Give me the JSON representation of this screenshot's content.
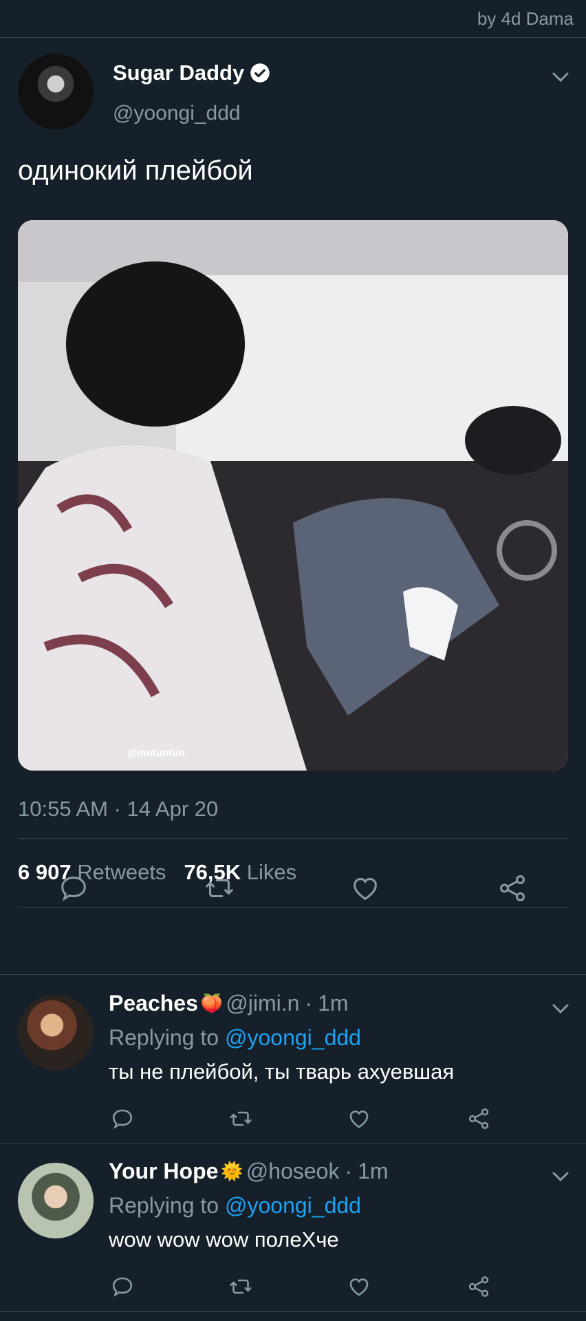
{
  "watermark": "by 4d Dama",
  "tweet": {
    "display_name": "Sugar Daddy",
    "handle": "@yoongi_ddd",
    "text": "одинокий плейбой",
    "photo_credit": "@mutuntun",
    "timestamp": "10:55 AM · 14 Apr 20",
    "retweets_count": "6 907",
    "retweets_label": "Retweets",
    "likes_count": "76,5K",
    "likes_label": "Likes"
  },
  "replies": [
    {
      "display_name": "Peaches",
      "emoji": "🍑",
      "handle": "@jimi.n",
      "dot": "·",
      "time": "1m",
      "replying_prefix": "Replying to",
      "replying_mention": "@yoongi_ddd",
      "text": "ты не плейбой, ты тварь ахуевшая"
    },
    {
      "display_name": "Your Hope",
      "emoji": "🌞",
      "handle": "@hoseok",
      "dot": "·",
      "time": "1m",
      "replying_prefix": "Replying to",
      "replying_mention": "@yoongi_ddd",
      "text": "wow wow wow полеХче"
    }
  ],
  "colors": {
    "background": "#15202b",
    "secondary_text": "#8899a6",
    "divider": "#38444d",
    "link": "#1da1f2"
  },
  "icons": [
    "verified-icon",
    "chevron-down-icon",
    "reply-icon",
    "retweet-icon",
    "like-icon",
    "share-icon"
  ]
}
